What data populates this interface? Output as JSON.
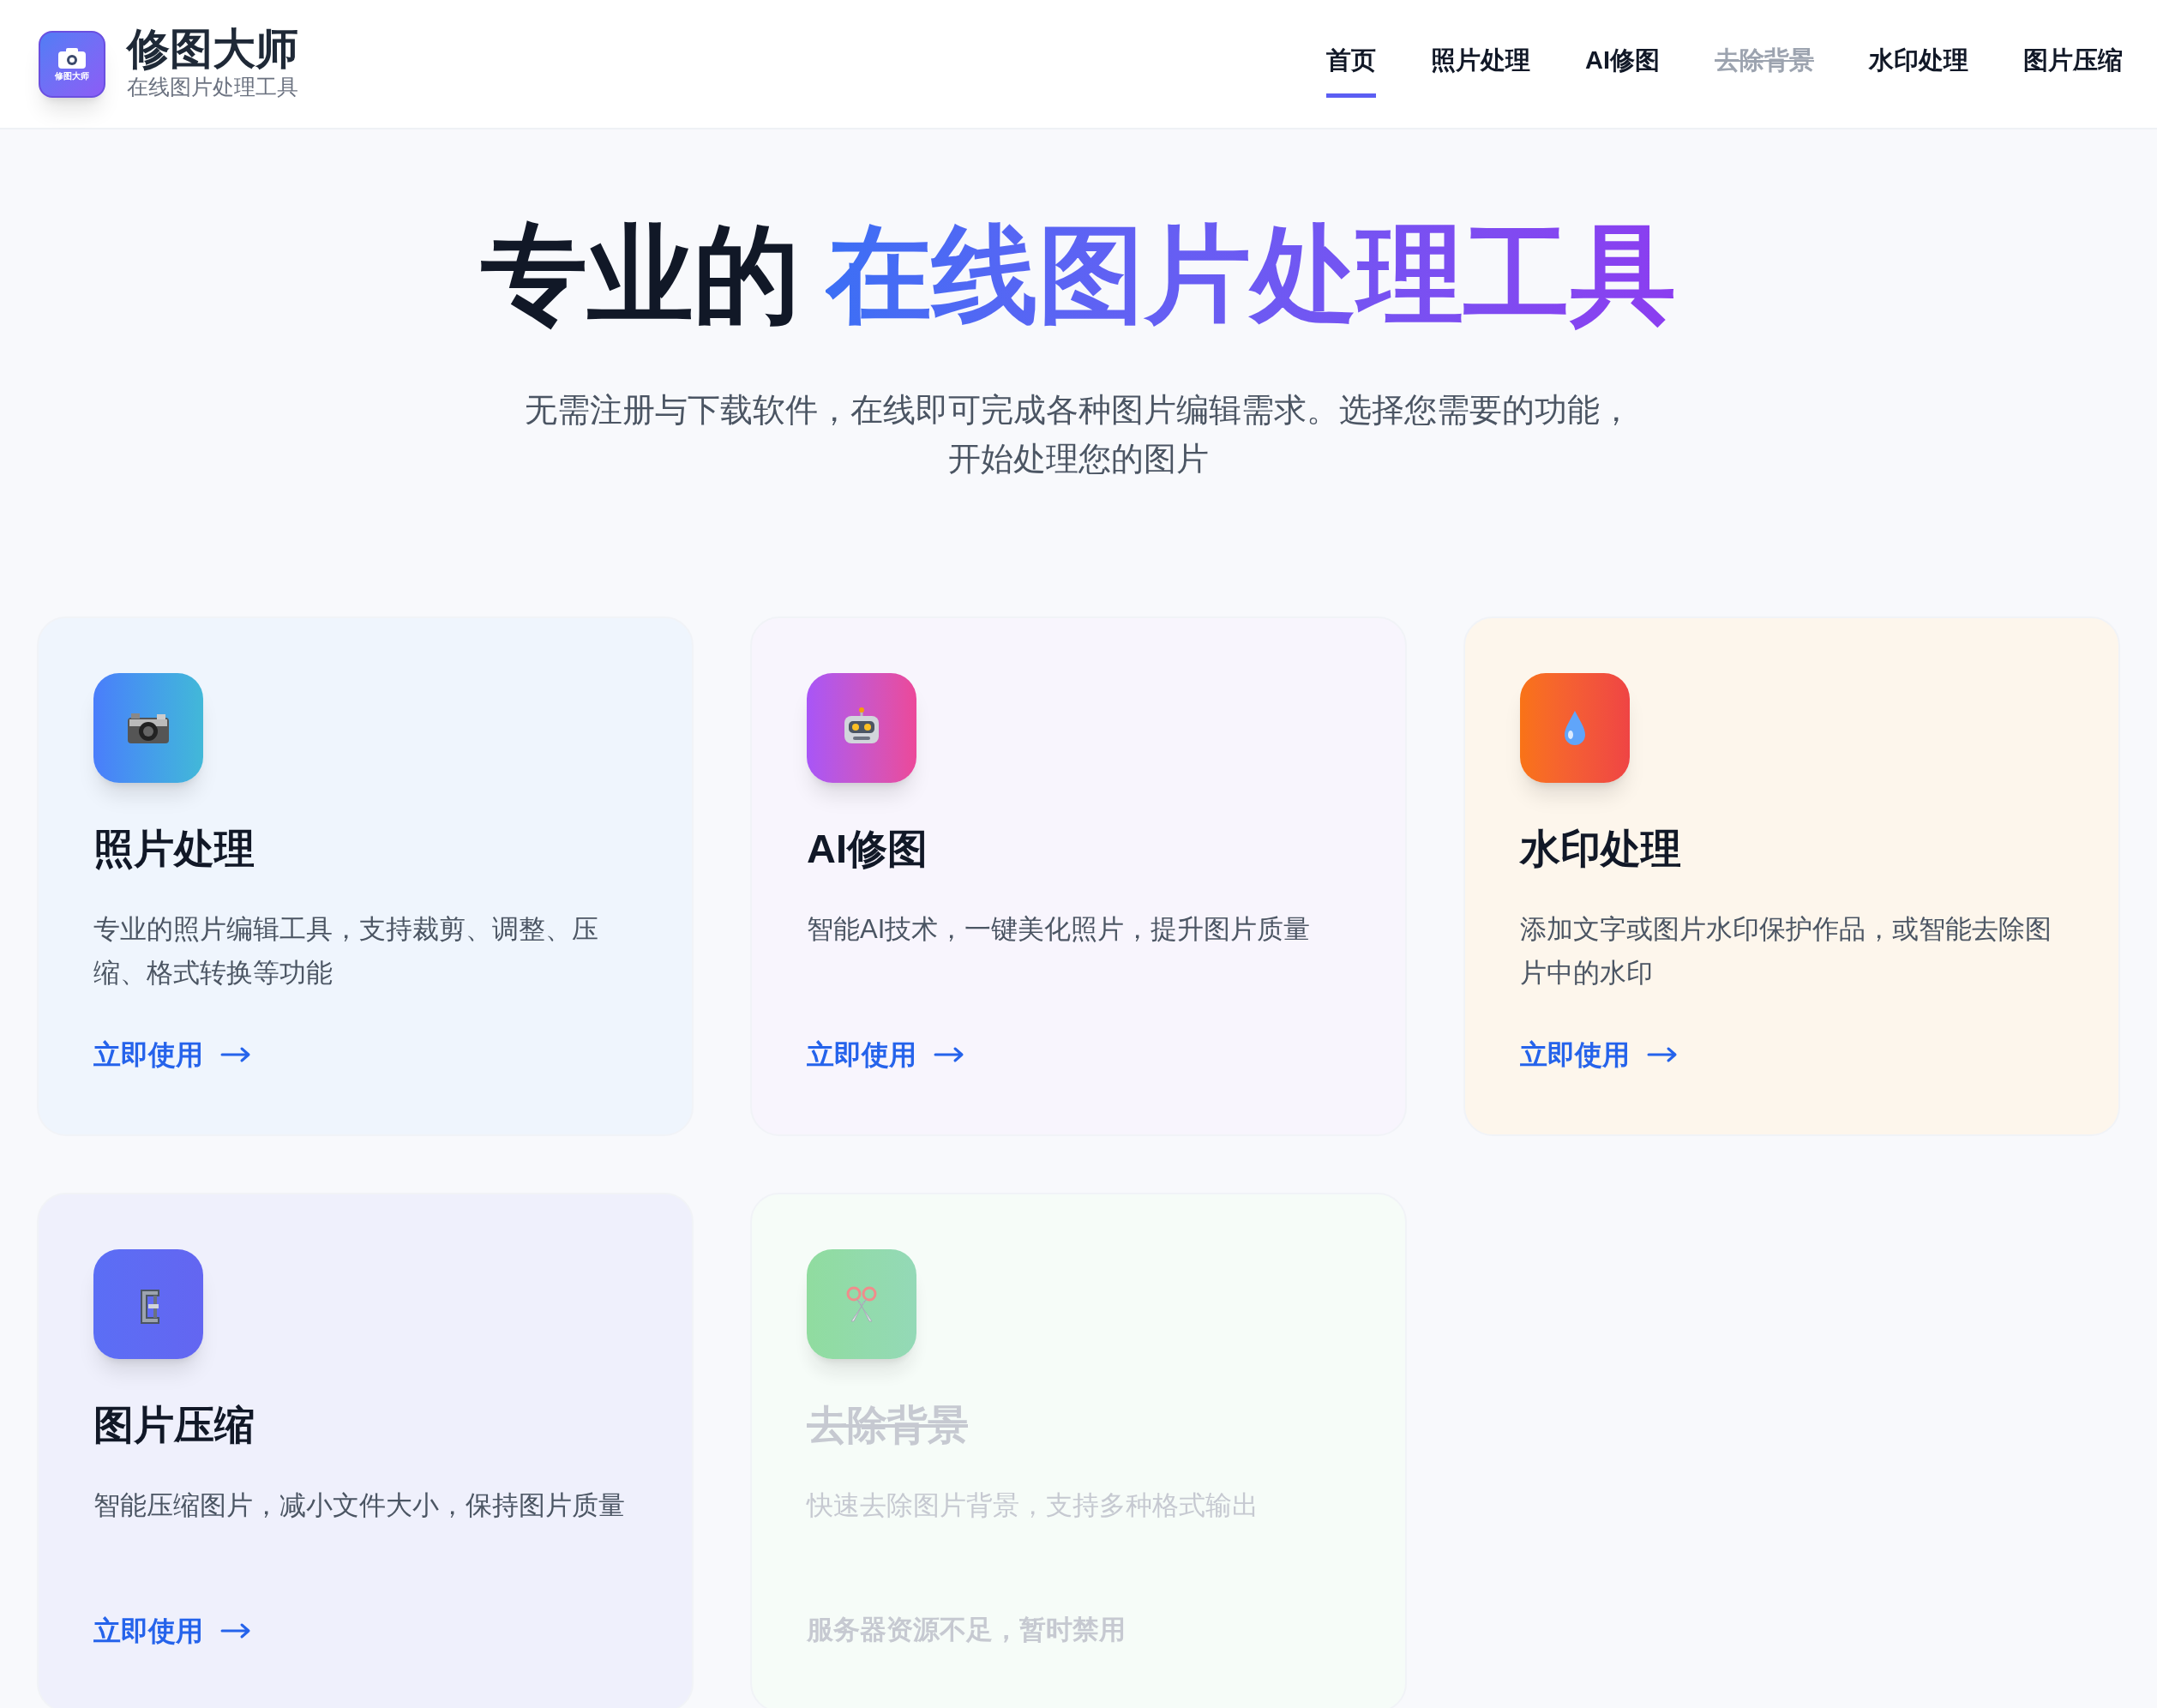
{
  "brand": {
    "logo_text": "修图大师",
    "name": "修图大师",
    "tagline": "在线图片处理工具"
  },
  "nav": [
    {
      "label": "首页",
      "selected": true,
      "disabled": false
    },
    {
      "label": "照片处理",
      "selected": false,
      "disabled": false
    },
    {
      "label": "AI修图",
      "selected": false,
      "disabled": false
    },
    {
      "label": "去除背景",
      "selected": false,
      "disabled": true
    },
    {
      "label": "水印处理",
      "selected": false,
      "disabled": false
    },
    {
      "label": "图片压缩",
      "selected": false,
      "disabled": false
    }
  ],
  "hero": {
    "title_lead": "专业的",
    "title_highlight": "在线图片处理工具",
    "subtitle": "无需注册与下载软件，在线即可完成各种图片编辑需求。选择您需要的功能，开始处理您的图片"
  },
  "cards": [
    {
      "kind": "camera",
      "title": "照片处理",
      "description": "专业的照片编辑工具，支持裁剪、调整、压缩、格式转换等功能",
      "disabled": false,
      "action": "立即使用"
    },
    {
      "kind": "robot",
      "title": "AI修图",
      "description": "智能AI技术，一键美化照片，提升图片质量",
      "disabled": false,
      "action": "立即使用"
    },
    {
      "kind": "drop",
      "title": "水印处理",
      "description": "添加文字或图片水印保护作品，或智能去除图片中的水印",
      "disabled": false,
      "action": "立即使用"
    },
    {
      "kind": "clamp",
      "title": "图片压缩",
      "description": "智能压缩图片，减小文件大小，保持图片质量",
      "disabled": false,
      "action": "立即使用"
    },
    {
      "kind": "scissors",
      "title": "去除背景",
      "description": "快速去除图片背景，支持多种格式输出",
      "disabled": true,
      "notice": "服务器资源不足，暂时禁用"
    }
  ]
}
